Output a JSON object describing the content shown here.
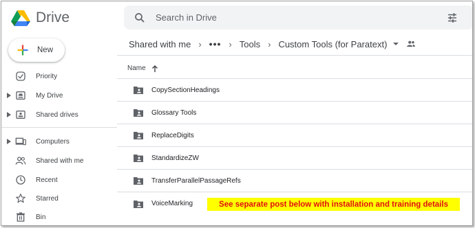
{
  "app": {
    "name": "Drive"
  },
  "search": {
    "placeholder": "Search in Drive"
  },
  "sidebar": {
    "new_label": "New",
    "items": [
      {
        "label": "Priority",
        "icon": "check-circle-icon"
      },
      {
        "label": "My Drive",
        "icon": "my-drive-icon"
      },
      {
        "label": "Shared drives",
        "icon": "shared-drives-icon"
      },
      {
        "label": "Computers",
        "icon": "computer-icon"
      },
      {
        "label": "Shared with me",
        "icon": "people-icon"
      },
      {
        "label": "Recent",
        "icon": "clock-icon"
      },
      {
        "label": "Starred",
        "icon": "star-icon"
      },
      {
        "label": "Bin",
        "icon": "trash-icon"
      }
    ]
  },
  "breadcrumb": {
    "root": "Shared with me",
    "more": "•••",
    "items": [
      "Tools",
      "Custom Tools (for Paratext)"
    ]
  },
  "list": {
    "column_name": "Name",
    "files": [
      "CopySectionHeadings",
      "Glossary Tools",
      "ReplaceDigits",
      "StandardizeZW",
      "TransferParallelPassageRefs",
      "VoiceMarking"
    ]
  },
  "annotation": "See separate post below with installation and training details",
  "colors": {
    "accent": "#1a73e8",
    "highlight": "#ffff00",
    "highlight_text": "#e01010"
  }
}
